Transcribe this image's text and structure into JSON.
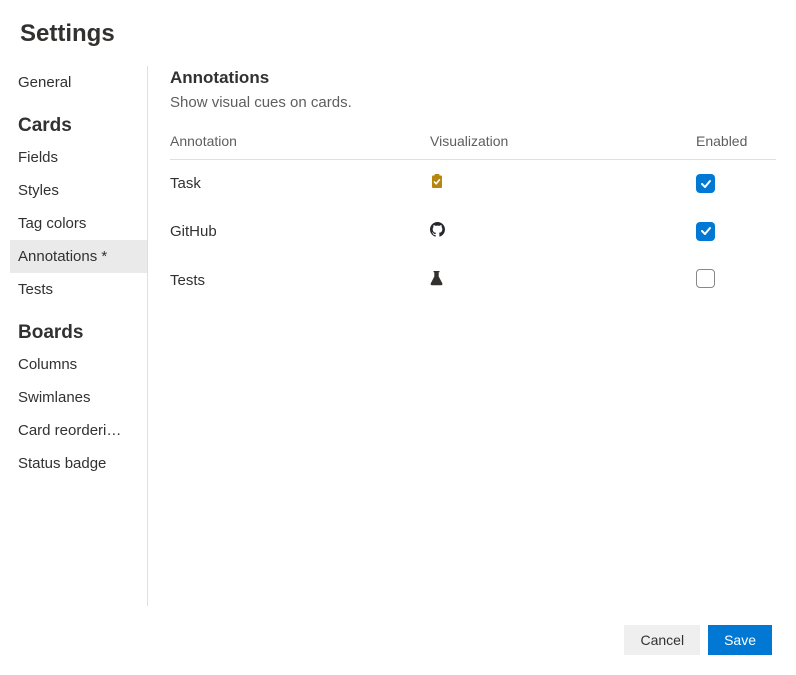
{
  "pageTitle": "Settings",
  "sidebar": {
    "topItem": "General",
    "sections": [
      {
        "header": "Cards",
        "items": [
          {
            "label": "Fields",
            "selected": false
          },
          {
            "label": "Styles",
            "selected": false
          },
          {
            "label": "Tag colors",
            "selected": false
          },
          {
            "label": "Annotations *",
            "selected": true
          },
          {
            "label": "Tests",
            "selected": false
          }
        ]
      },
      {
        "header": "Boards",
        "items": [
          {
            "label": "Columns",
            "selected": false
          },
          {
            "label": "Swimlanes",
            "selected": false
          },
          {
            "label": "Card reorderi…",
            "selected": false
          },
          {
            "label": "Status badge",
            "selected": false
          }
        ]
      }
    ]
  },
  "content": {
    "title": "Annotations",
    "subtitle": "Show visual cues on cards.",
    "columns": {
      "annotation": "Annotation",
      "visualization": "Visualization",
      "enabled": "Enabled"
    },
    "rows": [
      {
        "name": "Task",
        "icon": "clipboard",
        "enabled": true
      },
      {
        "name": "GitHub",
        "icon": "github",
        "enabled": true
      },
      {
        "name": "Tests",
        "icon": "beaker",
        "enabled": false
      }
    ]
  },
  "footer": {
    "cancel": "Cancel",
    "save": "Save"
  }
}
